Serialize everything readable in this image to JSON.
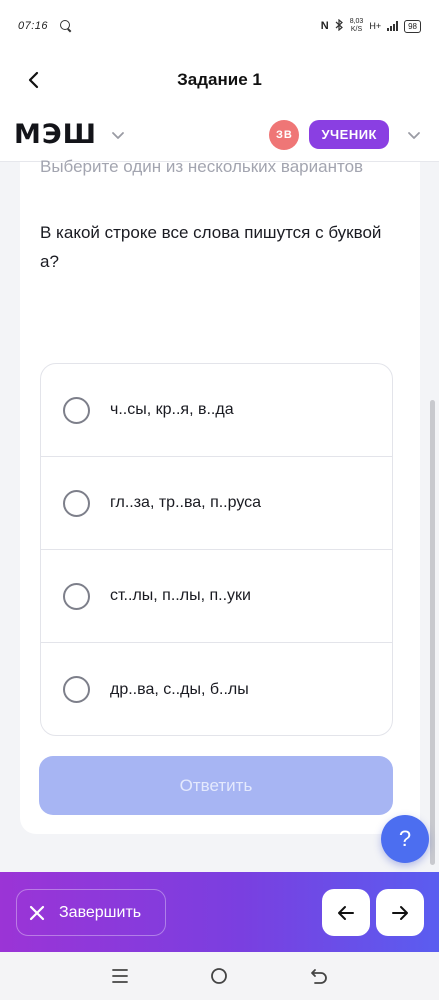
{
  "status_bar": {
    "time": "07:16",
    "nfc": "N",
    "speed_value": "8,03",
    "speed_unit": "K/S",
    "network": "H+",
    "battery": "98"
  },
  "header": {
    "title": "Задание 1"
  },
  "brand": {
    "logo": "МЭШ",
    "avatar_initials": "ЗВ",
    "role": "УЧЕНИК"
  },
  "task": {
    "instruction": "Выберите один из нескольких вариантов",
    "question": "В какой строке все слова пишутся с буквой а?",
    "options": [
      "ч..сы, кр..я, в..да",
      "гл..за, тр..ва, п..руса",
      "ст..лы, п..лы, п..уки",
      "др..ва, с..ды, б..лы"
    ],
    "submit_label": "Ответить"
  },
  "help": {
    "label": "?"
  },
  "bottom_bar": {
    "finish_label": "Завершить"
  },
  "colors": {
    "accent_purple": "#8a3fe2",
    "avatar_red": "#ef7676",
    "submit_disabled": "#a7b5f3",
    "help_blue": "#4c6ef0"
  }
}
